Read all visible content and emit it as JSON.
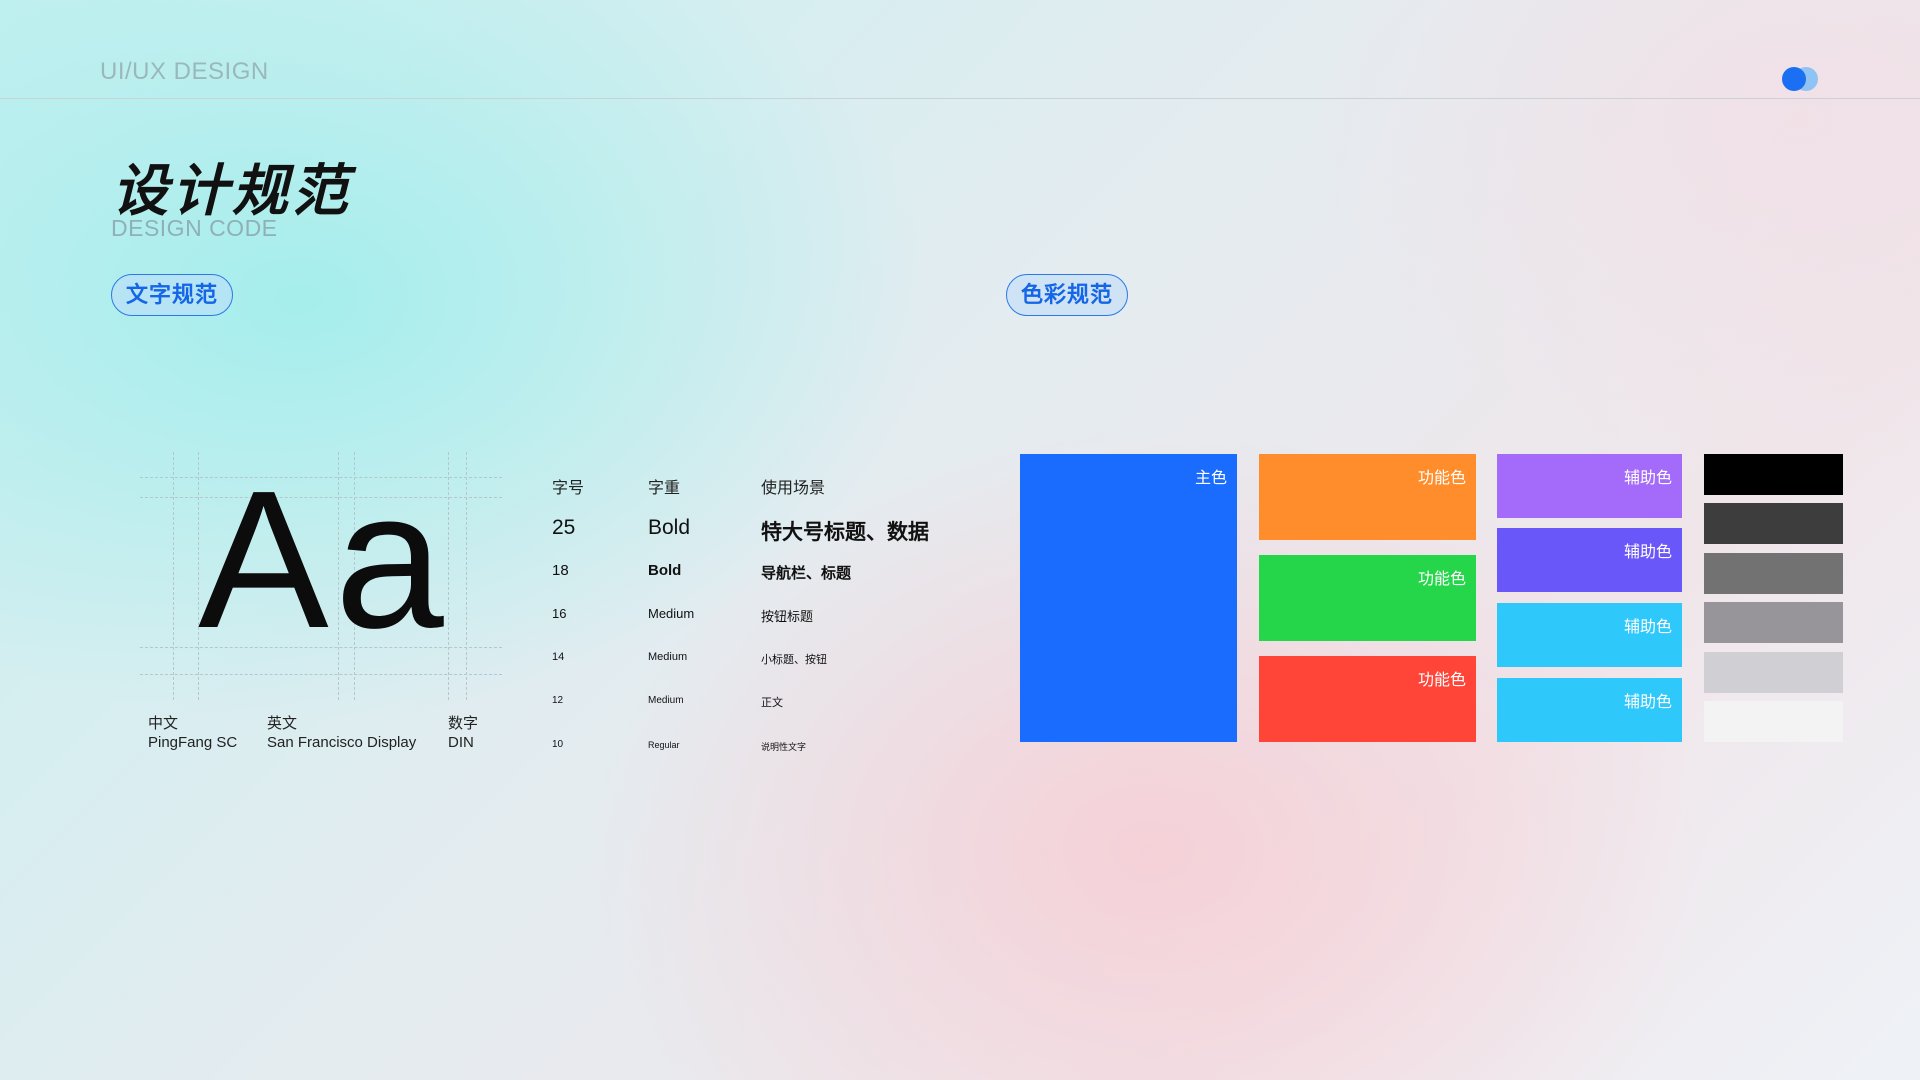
{
  "header": {
    "brand": "UI/UX DESIGN"
  },
  "title": {
    "main": "设计规范",
    "sub": "DESIGN CODE"
  },
  "sections": {
    "text_spec": "文字规范",
    "color_spec": "色彩规范"
  },
  "specimen": {
    "glyphs": "Aa"
  },
  "fonts": [
    {
      "label": "中文",
      "name": "PingFang SC"
    },
    {
      "label": "英文",
      "name": "San Francisco Display"
    },
    {
      "label": "数字",
      "name": "DIN"
    }
  ],
  "type_table": {
    "headers": [
      "字号",
      "字重",
      "使用场景"
    ],
    "rows": [
      {
        "size": "25",
        "weight": "Bold",
        "usage": "特大号标题、数据"
      },
      {
        "size": "18",
        "weight": "Bold",
        "usage": "导航栏、标题"
      },
      {
        "size": "16",
        "weight": "Medium",
        "usage": "按钮标题"
      },
      {
        "size": "14",
        "weight": "Medium",
        "usage": "小标题、按钮"
      },
      {
        "size": "12",
        "weight": "Medium",
        "usage": "正文"
      },
      {
        "size": "10",
        "weight": "Regular",
        "usage": "说明性文字"
      }
    ]
  },
  "colors": {
    "primary": {
      "label": "主色",
      "hex": "#1a6cff"
    },
    "functional": [
      {
        "label": "功能色",
        "hex": "#ff8d2b"
      },
      {
        "label": "功能色",
        "hex": "#26d64a"
      },
      {
        "label": "功能色",
        "hex": "#ff4438"
      }
    ],
    "auxiliary": [
      {
        "label": "辅助色",
        "hex": "#a46bfa"
      },
      {
        "label": "辅助色",
        "hex": "#6a57f9"
      },
      {
        "label": "辅助色",
        "hex": "#2ec8fb"
      },
      {
        "label": "辅助色",
        "hex": "#2ec8fb"
      }
    ],
    "neutrals": [
      "#000000",
      "#3d3d3d",
      "#727272",
      "#979599",
      "#d0cfd4",
      "#f3f3f3"
    ]
  }
}
